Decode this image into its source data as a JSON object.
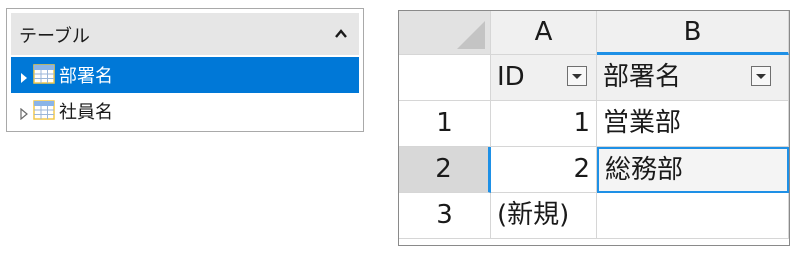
{
  "panel": {
    "title": "テーブル",
    "items": [
      {
        "label": "部署名",
        "selected": true
      },
      {
        "label": "社員名",
        "selected": false
      }
    ]
  },
  "grid": {
    "columns": [
      "A",
      "B"
    ],
    "fields": [
      "ID",
      "部署名"
    ],
    "rows": [
      {
        "row_num": "1",
        "id": "1",
        "name": "営業部"
      },
      {
        "row_num": "2",
        "id": "2",
        "name": "総務部"
      },
      {
        "row_num": "3",
        "id": "(新規)",
        "name": ""
      }
    ],
    "active_column": "B",
    "active_row": "2"
  },
  "colors": {
    "selection": "#0078d7",
    "active_border": "#1e90e6",
    "header_bg": "#f0f0f0"
  }
}
